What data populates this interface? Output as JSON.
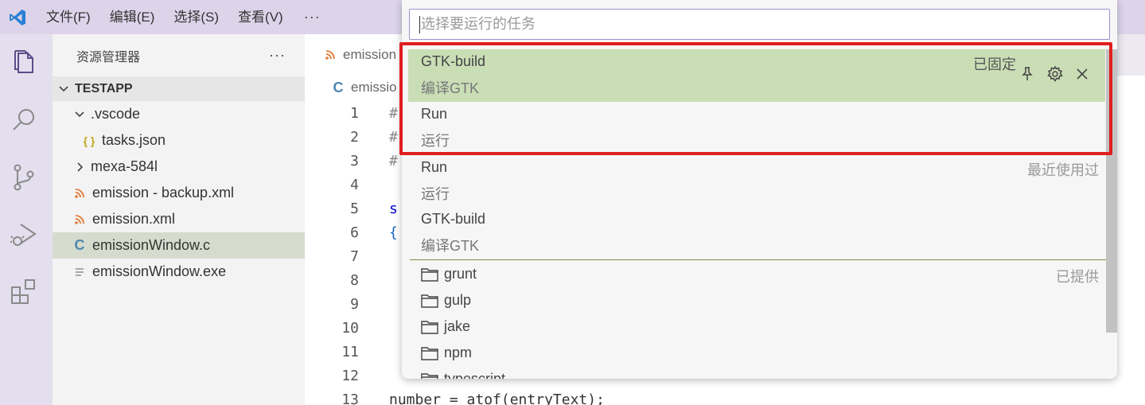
{
  "menubar": {
    "items": [
      "文件(F)",
      "编辑(E)",
      "选择(S)",
      "查看(V)"
    ],
    "more": "···"
  },
  "sidebar": {
    "title": "资源管理器",
    "more": "···",
    "section": "TESTAPP",
    "tree": [
      {
        "label": ".vscode",
        "type": "folder-open"
      },
      {
        "label": "tasks.json",
        "type": "json"
      },
      {
        "label": "mexa-584l",
        "type": "folder-closed"
      },
      {
        "label": "emission - backup.xml",
        "type": "xml"
      },
      {
        "label": "emission.xml",
        "type": "xml"
      },
      {
        "label": "emissionWindow.c",
        "type": "c"
      },
      {
        "label": "emissionWindow.exe",
        "type": "exe"
      }
    ]
  },
  "editor": {
    "tab_label": "emission",
    "breadcrumb": "emissio",
    "lines": [
      {
        "n": "1",
        "code": "#"
      },
      {
        "n": "2",
        "code": "#"
      },
      {
        "n": "3",
        "code": "#"
      },
      {
        "n": "4",
        "code": ""
      },
      {
        "n": "5",
        "code": "s"
      },
      {
        "n": "6",
        "code": "{"
      },
      {
        "n": "7",
        "code": ""
      },
      {
        "n": "8",
        "code": ""
      },
      {
        "n": "9",
        "code": ""
      },
      {
        "n": "10",
        "code": ""
      },
      {
        "n": "11",
        "code": ""
      },
      {
        "n": "12",
        "code": ""
      },
      {
        "n": "13",
        "code": "number = atof(entryText);"
      }
    ]
  },
  "quickpick": {
    "placeholder": "选择要运行的任务",
    "pinned": [
      {
        "label": "GTK-build",
        "desc": "编译GTK",
        "badge": "已固定"
      },
      {
        "label": "Run",
        "desc": "运行"
      }
    ],
    "recent": [
      {
        "label": "Run",
        "desc": "运行",
        "badge": "最近使用过"
      },
      {
        "label": "GTK-build",
        "desc": "编译GTK"
      }
    ],
    "provided_badge": "已提供",
    "providers": [
      "grunt",
      "gulp",
      "jake",
      "npm",
      "typescript"
    ]
  },
  "colors": {
    "accent": "#9f8fce",
    "active_item": "#cadeb6",
    "highlight_box": "#e01e1e",
    "titlebar": "#ddd4ea"
  }
}
